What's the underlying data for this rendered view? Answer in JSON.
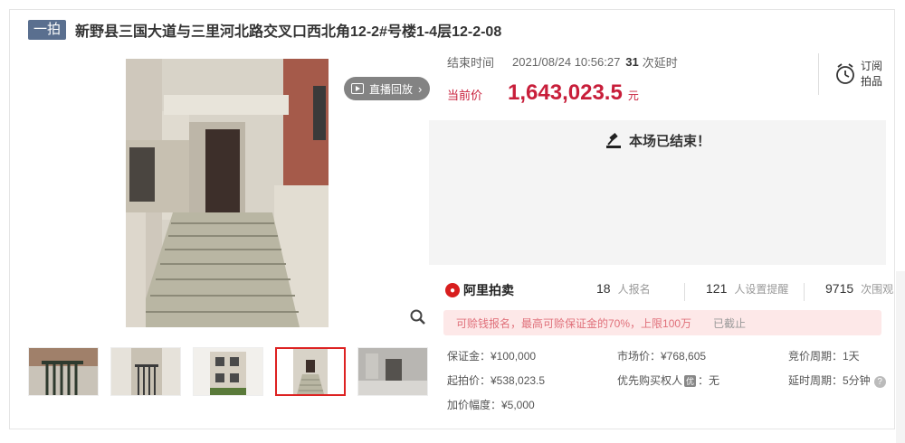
{
  "header": {
    "round_badge": "一拍",
    "title": "新野县三国大道与三里河北路交叉口西北角12-2#号楼1-4层12-2-08"
  },
  "gallery": {
    "replay_label": "直播回放",
    "replay_arrow": "›",
    "active_thumb": 4,
    "thumb_count": 5
  },
  "auction": {
    "end_time_label": "结束时间",
    "end_time": "2021/08/24 10:56:27",
    "delay_count": "31",
    "delay_suffix": "次延时",
    "current_price_label": "当前价",
    "current_price": "1,643,023.5",
    "currency_unit": "元",
    "subscribe_line1": "订阅",
    "subscribe_line2": "拍品",
    "ended_text": "本场已结束！"
  },
  "stats": {
    "logo_text": "阿里拍卖",
    "registrants_value": "18",
    "registrants_label": "人报名",
    "reminders_value": "121",
    "reminders_label": "人设置提醒",
    "views_value": "9715",
    "views_label": "次围观"
  },
  "notice": {
    "text": "可赊钱报名，最高可赊保证金的70%，上限100万",
    "status": "已截止"
  },
  "details": {
    "deposit": "保证金：¥100,000",
    "market_price": "市场价：¥768,605",
    "bid_period": "竞价周期：1天",
    "start_price": "起拍价：¥538,023.5",
    "priority_buyer_prefix": "优先购买权人",
    "priority_buyer_badge": "优",
    "priority_buyer_suffix": "：无",
    "delay_period": "延时周期：5分钟",
    "increment": "加价幅度：¥5,000",
    "help_glyph": "?"
  },
  "colors": {
    "accent": "#c81e3a",
    "badge": "#5a6f8f",
    "notice_bg": "#fde8e8"
  }
}
